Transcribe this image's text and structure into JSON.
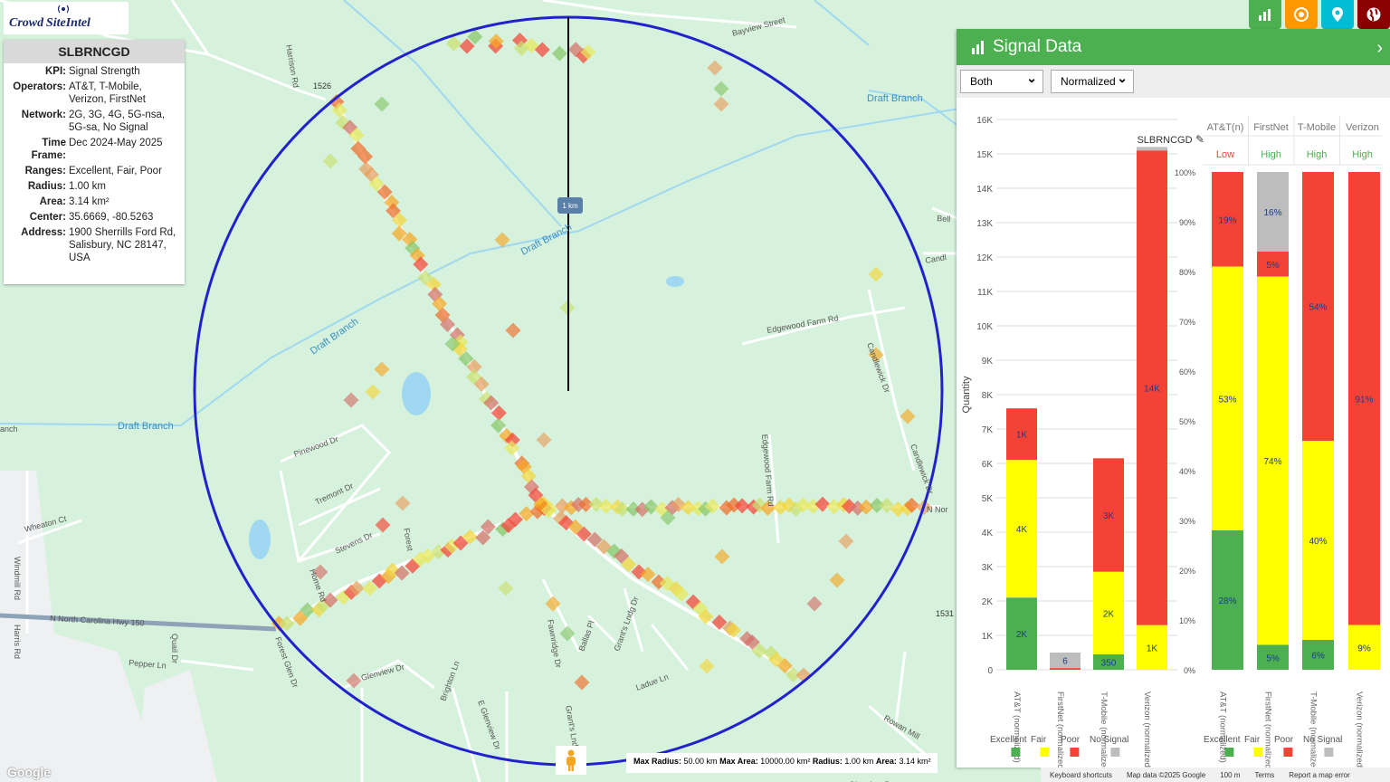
{
  "app": {
    "logo_text": "Crowd SiteIntel"
  },
  "info": {
    "title": "SLBRNCGD",
    "rows": [
      {
        "label": "KPI:",
        "value": "Signal Strength"
      },
      {
        "label": "Operators:",
        "value": "AT&T, T-Mobile, Verizon, FirstNet"
      },
      {
        "label": "Network:",
        "value": "2G, 3G, 4G, 5G-nsa, 5G-sa, No Signal"
      },
      {
        "label": "Time Frame:",
        "value": "Dec 2024-May 2025"
      },
      {
        "label": "Ranges:",
        "value": "Excellent, Fair, Poor"
      },
      {
        "label": "Radius:",
        "value": "1.00 km"
      },
      {
        "label": "Area:",
        "value": "3.14 km²"
      },
      {
        "label": "Center:",
        "value": "35.6669, -80.5263"
      },
      {
        "label": "Address:",
        "value": "1900 Sherrills Ford Rd, Salisbury, NC 28147, USA"
      }
    ]
  },
  "map": {
    "radius_label": "1 km",
    "labels": [
      "Bayview Street",
      "Harrison Rd",
      "1526",
      "Draft Branch",
      "Draft Branch",
      "Draft Branch",
      "Draft Branch",
      "Edgewood Farm Rd",
      "Candlewick Dr",
      "Candlewick Dr",
      "Pinewood Dr",
      "Tremont Dr",
      "Stevens Dr",
      "Wheaton Ct",
      "Windmill Rd",
      "N North Carolina Hwy 150",
      "Pepper Ln",
      "Forest Glen Dr",
      "Glenview Dr",
      "E Glenview Dr",
      "Brighton Ln",
      "Fawnridge Dr",
      "Ballas Pl",
      "Grant's Lndg Dr",
      "Ladue Ln",
      "Rowan Mill",
      "Edgewood Farm Rd",
      "1531",
      "N Nor",
      "Bell",
      "Candl",
      "anch",
      "Home Rd",
      "Forest",
      "Quail Dr",
      "Harris Rd",
      "Glenview Dr",
      "Grant's Lndg Dr"
    ],
    "colors": {
      "circle": "#2222cc",
      "water": "#9fd8f0",
      "road": "#ffffff",
      "hwy": "#8ea3b8"
    }
  },
  "status": {
    "text_1": "Max Radius:",
    "val_1": "50.00 km",
    "text_2": "Max Area:",
    "val_2": "10000.00 km²",
    "text_3": "Radius:",
    "val_3": "1.00 km",
    "text_4": "Area:",
    "val_4": "3.14 km²"
  },
  "footer": {
    "shortcuts": "Keyboard shortcuts",
    "mapdata": "Map data ©2025 Google",
    "scale": "100 m",
    "terms": "Terms",
    "report": "Report a map error",
    "google": "Google"
  },
  "toolbar": {
    "icons": [
      "bar-chart-icon",
      "target-icon",
      "location-pin-icon",
      "globe-icon"
    ],
    "colors": [
      "#4caf50",
      "#ff9800",
      "#00bcd4",
      "#8b0000"
    ]
  },
  "signal_panel": {
    "title": "Signal Data",
    "select_operator": "Both",
    "select_mode": "Normalized",
    "chart_title": "SLBRNCGD"
  },
  "chart_data": [
    {
      "type": "bar",
      "stacked": true,
      "categories": [
        "AT&T (normalized)",
        "FirstNet (normalized)",
        "T-Mobile (normalized)",
        "Verizon (normalized)"
      ],
      "series": [
        {
          "name": "Excellent",
          "color": "#4caf50",
          "values": [
            2100,
            0,
            450,
            0
          ],
          "labels": [
            "2K",
            "",
            "350",
            ""
          ]
        },
        {
          "name": "Fair",
          "color": "#ffff00",
          "values": [
            4000,
            0,
            2400,
            1300
          ],
          "labels": [
            "4K",
            "",
            "2K",
            "1K"
          ]
        },
        {
          "name": "Poor",
          "color": "#f44336",
          "values": [
            1500,
            50,
            3300,
            13800
          ],
          "labels": [
            "1K",
            "",
            "3K",
            "14K"
          ]
        },
        {
          "name": "No Signal",
          "color": "#bdbdbd",
          "values": [
            0,
            450,
            0,
            100
          ],
          "labels": [
            "",
            "6",
            "",
            ""
          ]
        }
      ],
      "ylabel": "Quantity",
      "ylim": [
        0,
        16000
      ],
      "yticks": [
        "0",
        "1K",
        "2K",
        "3K",
        "4K",
        "5K",
        "6K",
        "7K",
        "8K",
        "9K",
        "10K",
        "11K",
        "12K",
        "13K",
        "14K",
        "15K",
        "16K"
      ],
      "legend": "bottom",
      "grid": true
    },
    {
      "type": "bar",
      "stacked": true,
      "percent": true,
      "categories": [
        "AT&T (normalized)",
        "FirstNet (normalized)",
        "T-Mobile (normalized)",
        "Verizon (normalized)"
      ],
      "headers": [
        "AT&T(n)",
        "FirstNet",
        "T-Mobile",
        "Verizon"
      ],
      "ratings": [
        "Low",
        "High",
        "High",
        "High"
      ],
      "rating_colors": [
        "#f44336",
        "#4caf50",
        "#4caf50",
        "#4caf50"
      ],
      "series": [
        {
          "name": "Excellent",
          "color": "#4caf50",
          "values": [
            28,
            5,
            6,
            0
          ],
          "labels": [
            "28%",
            "5%",
            "6%",
            ""
          ]
        },
        {
          "name": "Fair",
          "color": "#ffff00",
          "values": [
            53,
            74,
            40,
            9
          ],
          "labels": [
            "53%",
            "74%",
            "40%",
            "9%"
          ]
        },
        {
          "name": "Poor",
          "color": "#f44336",
          "values": [
            19,
            5,
            54,
            91
          ],
          "labels": [
            "19%",
            "5%",
            "54%",
            "91%"
          ]
        },
        {
          "name": "No Signal",
          "color": "#bdbdbd",
          "values": [
            0,
            16,
            0,
            0
          ],
          "labels": [
            "",
            "16%",
            "",
            ""
          ]
        }
      ],
      "ylim": [
        0,
        100
      ],
      "yticks": [
        "0%",
        "10%",
        "20%",
        "30%",
        "40%",
        "50%",
        "60%",
        "70%",
        "80%",
        "90%",
        "100%"
      ],
      "legend": "bottom"
    }
  ]
}
